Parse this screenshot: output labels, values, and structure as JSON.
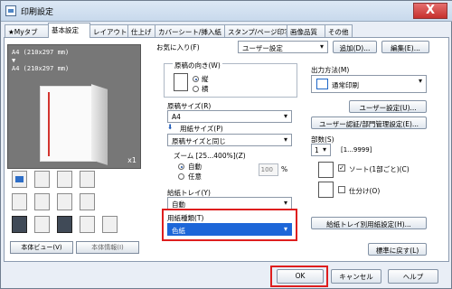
{
  "window": {
    "title": "印刷設定",
    "close": "X"
  },
  "tabs": [
    {
      "label": "Myタブ"
    },
    {
      "label": "基本設定"
    },
    {
      "label": "レイアウト"
    },
    {
      "label": "仕上げ"
    },
    {
      "label": "カバーシート/挿入紙"
    },
    {
      "label": "スタンプ/ページ印字"
    },
    {
      "label": "画像品質"
    },
    {
      "label": "その他"
    }
  ],
  "preview": {
    "paper_text": "A4 (210x297 mm)\n▼\nA4 (210x297 mm)",
    "scale": "x1"
  },
  "left_buttons": {
    "body_view": "本体ビュー(V)",
    "body_info": "本体情報(I)"
  },
  "favorites": {
    "label": "お気に入り(F)",
    "value": "ユーザー設定",
    "add": "追加(D)...",
    "edit": "編集(E)..."
  },
  "orientation": {
    "title": "原稿の向き(W)",
    "portrait": "縦",
    "landscape": "横"
  },
  "original_size": {
    "label": "原稿サイズ(R)",
    "value": "A4"
  },
  "paper_size": {
    "label": "用紙サイズ(P)",
    "value": "原稿サイズと同じ"
  },
  "zoom": {
    "label": "ズーム [25...400%](Z)",
    "auto": "自動",
    "custom": "任意",
    "value": "100",
    "unit": "%"
  },
  "paper_tray": {
    "label": "給紙トレイ(Y)",
    "value": "自動"
  },
  "paper_type": {
    "label": "用紙種類(T)",
    "value": "色紙"
  },
  "output": {
    "label": "出力方法(M)",
    "value": "通常印刷"
  },
  "buttons": {
    "user_settings": "ユーザー設定(U)...",
    "auth": "ユーザー認証/部門管理設定(E)...",
    "tray_paper": "給紙トレイ別用紙設定(H)...",
    "default": "標準に戻す(L)",
    "ok": "OK",
    "cancel": "キャンセル",
    "help": "ヘルプ"
  },
  "copies": {
    "label": "部数(S)",
    "value": "1",
    "range": "[1...9999]",
    "collate": "ソート(1部ごと)(C)",
    "offset": "仕分け(O)"
  },
  "colors": {
    "highlight": "#de1e1e",
    "selected": "#1d66d8"
  }
}
